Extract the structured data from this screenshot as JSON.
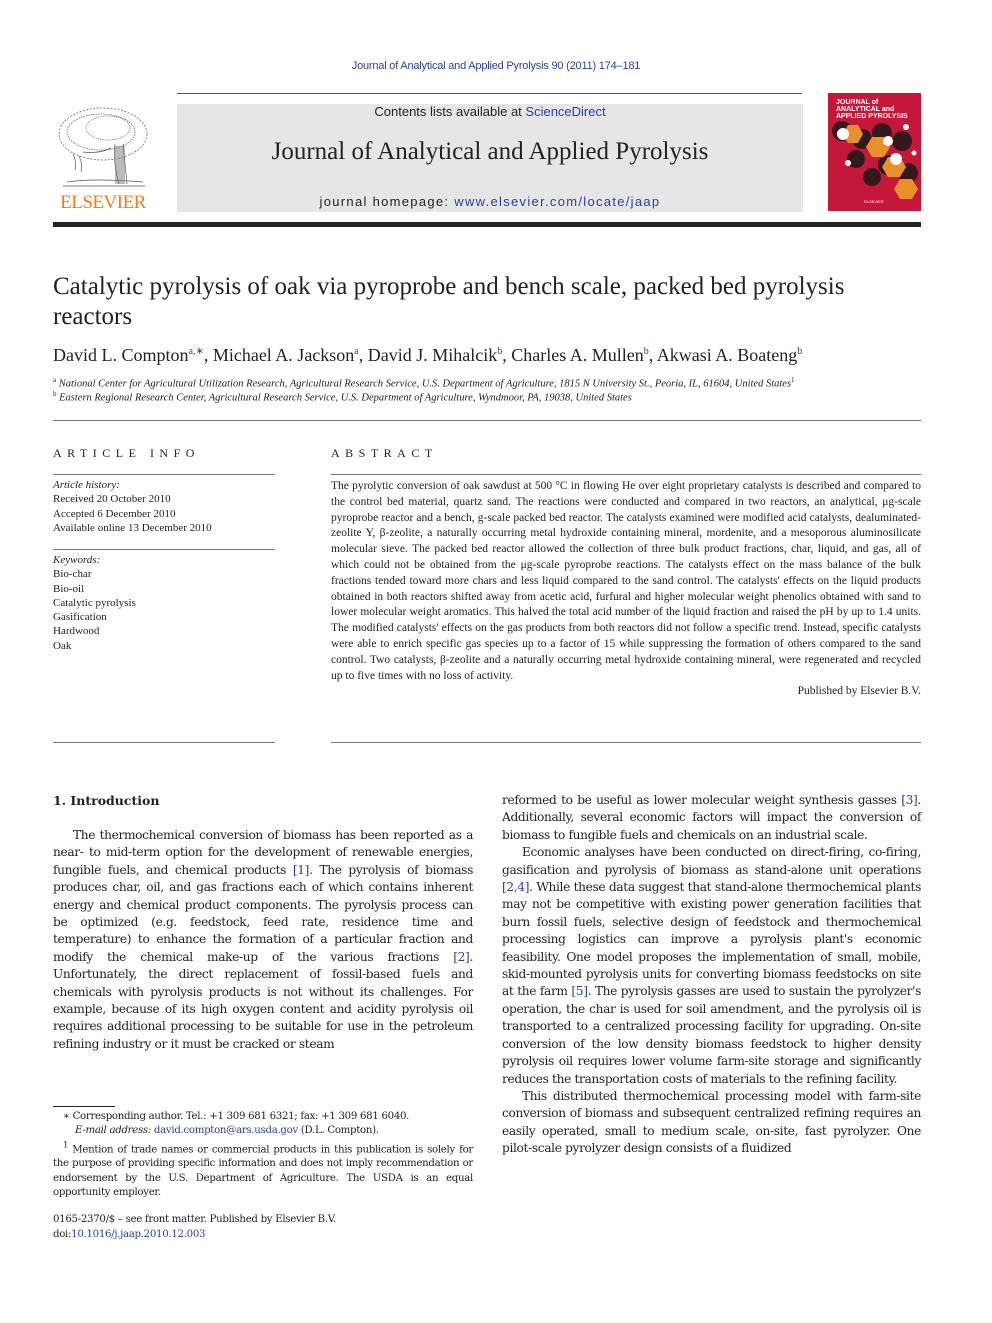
{
  "running_head": "Journal of Analytical and Applied Pyrolysis 90 (2011) 174–181",
  "masthead": {
    "publisher_logo": "ELSEVIER",
    "contents_prefix": "Contents lists available at ",
    "contents_link": "ScienceDirect",
    "journal_title": "Journal of Analytical and Applied Pyrolysis",
    "homepage_prefix": "journal homepage: ",
    "homepage_link": "www.elsevier.com/locate/jaap",
    "cover_lines": [
      "JOURNAL of",
      "ANALYTICAL and",
      "APPLIED PYROLYSIS"
    ],
    "colors": {
      "link": "#2a3f9c",
      "elsevier_orange": "#f07d1a",
      "cover_red": "#c4173a",
      "cover_orange": "#e8902a"
    }
  },
  "article": {
    "title": "Catalytic pyrolysis of oak via pyroprobe and bench scale, packed bed pyrolysis reactors",
    "authors": [
      {
        "name": "David L. Compton",
        "sup": "a,∗"
      },
      {
        "name": "Michael A. Jackson",
        "sup": "a"
      },
      {
        "name": "David J. Mihalcik",
        "sup": "b"
      },
      {
        "name": "Charles A. Mullen",
        "sup": "b"
      },
      {
        "name": "Akwasi A. Boateng",
        "sup": "b"
      }
    ],
    "affiliations": [
      {
        "mark": "a",
        "text": "National Center for Agricultural Utilization Research, Agricultural Research Service, U.S. Department of Agriculture, 1815 N University St., Peoria, IL, 61604, United States",
        "note": "1"
      },
      {
        "mark": "b",
        "text": "Eastern Regional Research Center, Agricultural Research Service, U.S. Department of Agriculture, Wyndmoor, PA, 19038, United States",
        "note": ""
      }
    ]
  },
  "article_info": {
    "heading": "ARTICLE INFO",
    "history_label": "Article history:",
    "history": [
      "Received 20 October 2010",
      "Accepted 6 December 2010",
      "Available online 13 December 2010"
    ],
    "keywords_label": "Keywords:",
    "keywords": [
      "Bio-char",
      "Bio-oil",
      "Catalytic pyrolysis",
      "Gasification",
      "Hardwood",
      "Oak"
    ]
  },
  "abstract": {
    "heading": "ABSTRACT",
    "text": "The pyrolytic conversion of oak sawdust at 500 °C in flowing He over eight proprietary catalysts is described and compared to the control bed material, quartz sand. The reactions were conducted and compared in two reactors, an analytical, μg-scale pyroprobe reactor and a bench, g-scale packed bed reactor. The catalysts examined were modified acid catalysts, dealuminated-zeolite Y, β-zeolite, a naturally occurring metal hydroxide containing mineral, mordenite, and a mesoporous aluminosilicate molecular sieve. The packed bed reactor allowed the collection of three bulk product fractions, char, liquid, and gas, all of which could not be obtained from the μg-scale pyroprobe reactions. The catalysts effect on the mass balance of the bulk fractions tended toward more chars and less liquid compared to the sand control. The catalysts' effects on the liquid products obtained in both reactors shifted away from acetic acid, furfural and higher molecular weight phenolics obtained with sand to lower molecular weight aromatics. This halved the total acid number of the liquid fraction and raised the pH by up to 1.4 units. The modified catalysts' effects on the gas products from both reactors did not follow a specific trend. Instead, specific catalysts were able to enrich specific gas species up to a factor of 15 while suppressing the formation of others compared to the sand control. Two catalysts, β-zeolite and a naturally occurring metal hydroxide containing mineral, were regenerated and recycled up to five times with no loss of activity.",
    "publisher": "Published by Elsevier B.V."
  },
  "introduction": {
    "heading": "1.  Introduction",
    "left_col": [
      {
        "parts": [
          {
            "t": "The thermochemical conversion of biomass has been reported as a near- to mid-term option for the development of renewable energies, fungible fuels, and chemical products "
          },
          {
            "ref": "[1]"
          },
          {
            "t": ". The pyrolysis of biomass produces char, oil, and gas fractions each of which contains inherent energy and chemical product components. The pyrolysis process can be optimized (e.g. feedstock, feed rate, residence time and temperature) to enhance the formation of a particular fraction and modify the chemical make-up of the various fractions "
          },
          {
            "ref": "[2]"
          },
          {
            "t": ". Unfortunately, the direct replacement of fossil-based fuels and chemicals with pyrolysis products is not without its challenges. For example, because of its high oxygen content and acidity pyrolysis oil requires additional processing to be suitable for use in the petroleum refining industry or it must be cracked or steam"
          }
        ]
      }
    ],
    "right_col": [
      {
        "indent": false,
        "parts": [
          {
            "t": "reformed to be useful as lower molecular weight synthesis gasses "
          },
          {
            "ref": "[3]"
          },
          {
            "t": ". Additionally, several economic factors will impact the conversion of biomass to fungible fuels and chemicals on an industrial scale."
          }
        ]
      },
      {
        "indent": true,
        "parts": [
          {
            "t": "Economic analyses have been conducted on direct-firing, co-firing, gasification and pyrolysis of biomass as stand-alone unit operations "
          },
          {
            "ref": "[2,4]"
          },
          {
            "t": ". While these data suggest that stand-alone thermochemical plants may not be competitive with existing power generation facilities that burn fossil fuels, selective design of feedstock and thermochemical processing logistics can improve a pyrolysis plant's economic feasibility. One model proposes the implementation of small, mobile, skid-mounted pyrolysis units for converting biomass feedstocks on site at the farm "
          },
          {
            "ref": "[5]"
          },
          {
            "t": ". The pyrolysis gasses are used to sustain the pyrolyzer's operation, the char is used for soil amendment, and the pyrolysis oil is transported to a centralized processing facility for upgrading. On-site conversion of the low density biomass feedstock to higher density pyrolysis oil requires lower volume farm-site storage and significantly reduces the transportation costs of materials to the refining facility."
          }
        ]
      },
      {
        "indent": true,
        "parts": [
          {
            "t": "This distributed thermochemical processing model with farm-site conversion of biomass and subsequent centralized refining requires an easily operated, small to medium scale, on-site, fast pyrolyzer. One pilot-scale pyrolyzer design consists of a fluidized"
          }
        ]
      }
    ]
  },
  "footnotes": {
    "corresponding": "∗  Corresponding author. Tel.: +1 309 681 6321; fax: +1 309 681 6040.",
    "email_label": "E-mail address: ",
    "email": "david.compton@ars.usda.gov",
    "email_suffix": " (D.L. Compton).",
    "note1_mark": "1",
    "note1": " Mention of trade names or commercial products in this publication is solely for the purpose of providing specific information and does not imply recommendation or endorsement by the U.S. Department of Agriculture. The USDA is an equal opportunity employer."
  },
  "front_matter": {
    "issn_line": "0165-2370/$ – see front matter. Published by Elsevier B.V.",
    "doi_prefix": "doi:",
    "doi": "10.1016/j.jaap.2010.12.003"
  }
}
